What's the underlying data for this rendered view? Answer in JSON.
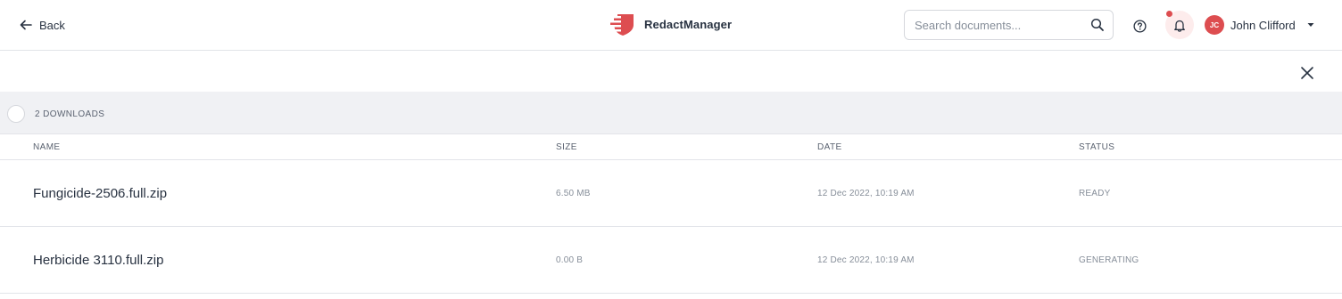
{
  "header": {
    "back_label": "Back",
    "brand_name": "RedactManager",
    "search_placeholder": "Search documents...",
    "user": {
      "initials": "JC",
      "name": "John Clifford"
    },
    "notification_unread": true
  },
  "downloads": {
    "count_label": "2 DOWNLOADS",
    "columns": {
      "name": "NAME",
      "size": "SIZE",
      "date": "DATE",
      "status": "STATUS"
    },
    "rows": [
      {
        "name": "Fungicide-2506.full.zip",
        "size": "6.50 MB",
        "date": "12 Dec 2022, 10:19 AM",
        "status": "READY"
      },
      {
        "name": "Herbicide 3110.full.zip",
        "size": "0.00 B",
        "date": "12 Dec 2022, 10:19 AM",
        "status": "GENERATING"
      }
    ]
  },
  "icons": {
    "back": "arrow-left-icon",
    "logo": "shield-logo-icon",
    "search": "search-icon",
    "help": "help-circle-icon",
    "notifications": "bell-icon",
    "user_menu": "caret-down-icon",
    "close": "close-icon"
  },
  "colors": {
    "brand_red": "#dd4d50",
    "header_band": "#f0f1f4",
    "text": "#283241"
  }
}
